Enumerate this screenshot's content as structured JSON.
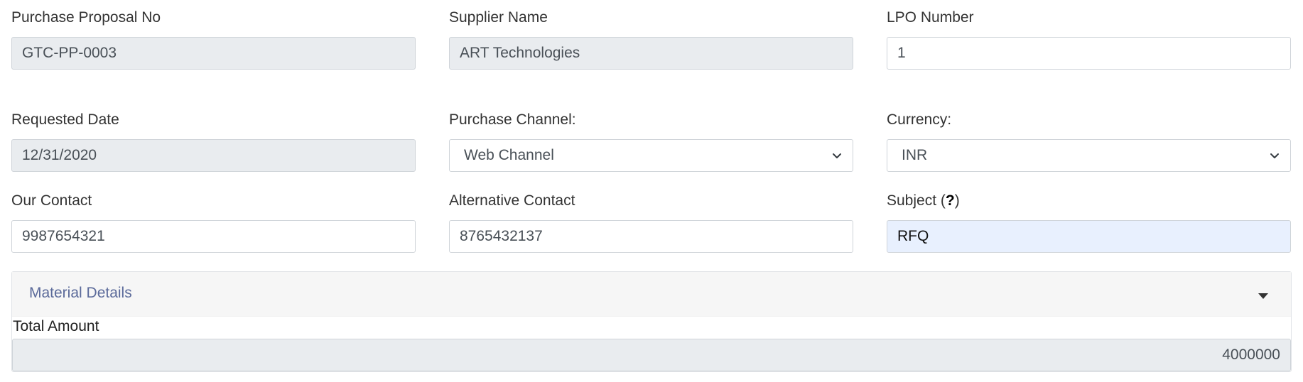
{
  "form": {
    "row1": {
      "purchase_proposal_no": {
        "label": "Purchase Proposal No",
        "value": "GTC-PP-0003"
      },
      "supplier_name": {
        "label": "Supplier Name",
        "value": "ART Technologies"
      },
      "lpo_number": {
        "label": "LPO Number",
        "value": "1"
      }
    },
    "row2": {
      "requested_date": {
        "label": "Requested Date",
        "value": "12/31/2020"
      },
      "purchase_channel": {
        "label": "Purchase Channel:",
        "selected": "Web Channel"
      },
      "currency": {
        "label": "Currency:",
        "selected": "INR"
      }
    },
    "row3": {
      "our_contact": {
        "label": "Our Contact",
        "value": "9987654321"
      },
      "alternative_contact": {
        "label": "Alternative Contact",
        "value": "8765432137"
      },
      "subject": {
        "label_prefix": "Subject (",
        "label_help": "?",
        "label_suffix": ")",
        "value": "RFQ"
      }
    }
  },
  "material_details": {
    "title": "Material Details",
    "total_amount_label": "Total Amount",
    "total_amount_value": "4000000"
  },
  "icons": {
    "select_chevron": "chevron-down-icon",
    "panel_toggle": "caret-down-icon"
  },
  "colors": {
    "readonly_bg": "#e9ecef",
    "autofill_bg": "#e8f0fe",
    "panel_title": "#5b6a9a",
    "border": "#cfd4d9"
  }
}
